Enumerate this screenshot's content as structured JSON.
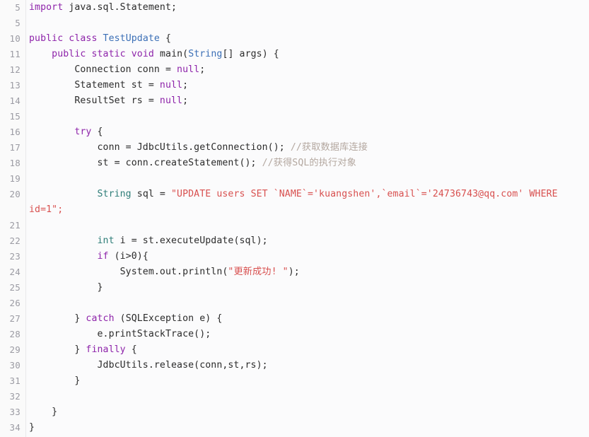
{
  "editor": {
    "name": "java-code-editor",
    "language": "Java",
    "background_color": "#fbfbfc",
    "gutter_color": "#fafafa",
    "gutter_text_color": "#9b9ba3",
    "default_text_color": "#2b2b2b",
    "colors": {
      "keyword": "#8e24aa",
      "type": "#2e7d78",
      "class_name": "#3b6fb6",
      "string": "#d8504f",
      "comment": "#b4a8a0",
      "plain": "#2b2b2b"
    },
    "line_numbers": [
      "5",
      "5",
      "10",
      "11",
      "12",
      "13",
      "14",
      "15",
      "16",
      "17",
      "18",
      "19",
      "20",
      "",
      "21",
      "22",
      "23",
      "24",
      "25",
      "26",
      "27",
      "28",
      "29",
      "30",
      "31",
      "32",
      "33",
      "34"
    ],
    "lines": [
      {
        "number": "5",
        "text": "import java.sql.Statement;"
      },
      {
        "number": "5",
        "text": ""
      },
      {
        "number": "10",
        "text": "public class TestUpdate {"
      },
      {
        "number": "11",
        "text": "    public static void main(String[] args) {"
      },
      {
        "number": "12",
        "text": "        Connection conn = null;"
      },
      {
        "number": "13",
        "text": "        Statement st = null;"
      },
      {
        "number": "14",
        "text": "        ResultSet rs = null;"
      },
      {
        "number": "15",
        "text": ""
      },
      {
        "number": "16",
        "text": "        try {"
      },
      {
        "number": "17",
        "text": "            conn = JdbcUtils.getConnection(); //获取数据库连接"
      },
      {
        "number": "18",
        "text": "            st = conn.createStatement(); //获得SQL的执行对象"
      },
      {
        "number": "19",
        "text": ""
      },
      {
        "number": "20",
        "text": "            String sql = \"UPDATE users SET `NAME`='kuangshen',`email`='24736743@qq.com' WHERE id=1\";"
      },
      {
        "number": "",
        "text": "id=1\";"
      },
      {
        "number": "21",
        "text": ""
      },
      {
        "number": "22",
        "text": "            int i = st.executeUpdate(sql);"
      },
      {
        "number": "23",
        "text": "            if (i>0){"
      },
      {
        "number": "24",
        "text": "                System.out.println(\"更新成功! \");"
      },
      {
        "number": "25",
        "text": "            }"
      },
      {
        "number": "26",
        "text": ""
      },
      {
        "number": "27",
        "text": "        } catch (SQLException e) {"
      },
      {
        "number": "28",
        "text": "            e.printStackTrace();"
      },
      {
        "number": "29",
        "text": "        } finally {"
      },
      {
        "number": "30",
        "text": "            JdbcUtils.release(conn,st,rs);"
      },
      {
        "number": "31",
        "text": "        }"
      },
      {
        "number": "32",
        "text": ""
      },
      {
        "number": "33",
        "text": "    }"
      },
      {
        "number": "34",
        "text": "}"
      }
    ],
    "tokens": {
      "import": "import",
      "java_sql_statement": " java.sql.Statement;",
      "public": "public",
      "class": "class",
      "test_update": "TestUpdate",
      "brace_open": " {",
      "static": "static",
      "void": "void",
      "main": "main(",
      "string_type": "String",
      "args": "[] args) {",
      "connection": "Connection conn = ",
      "null": "null",
      "semicolon": ";",
      "statement": "Statement st = ",
      "resultset": "ResultSet rs = ",
      "try": "try",
      "conn_get": "conn = JdbcUtils.getConnection(); ",
      "comment_get_conn": "//获取数据库连接",
      "st_create": "st = conn.createStatement(); ",
      "comment_get_sql": "//获得SQL的执行对象",
      "sql_decl": " sql = ",
      "sql_literal": "\"UPDATE users SET `NAME`='kuangshen',`email`='24736743@qq.com' WHERE",
      "sql_literal_wrap": "id=1\";",
      "int": "int",
      "int_rest": " i = st.executeUpdate(sql);",
      "if": "if",
      "if_rest": " (i>0){",
      "println_pre": "System.out.println(",
      "println_str": "\"更新成功! \"",
      "println_post": ");",
      "close_brace": "}",
      "catch_pre": "} ",
      "catch": "catch",
      "catch_rest": " (SQLException e) {",
      "print_stack": "e.printStackTrace();",
      "finally": "finally",
      "finally_rest": " {",
      "release": "JdbcUtils.release(conn,st,rs);",
      "close_brace_indent8": "        }",
      "close_brace_indent4": "    }",
      "close_brace_0": "}"
    }
  }
}
